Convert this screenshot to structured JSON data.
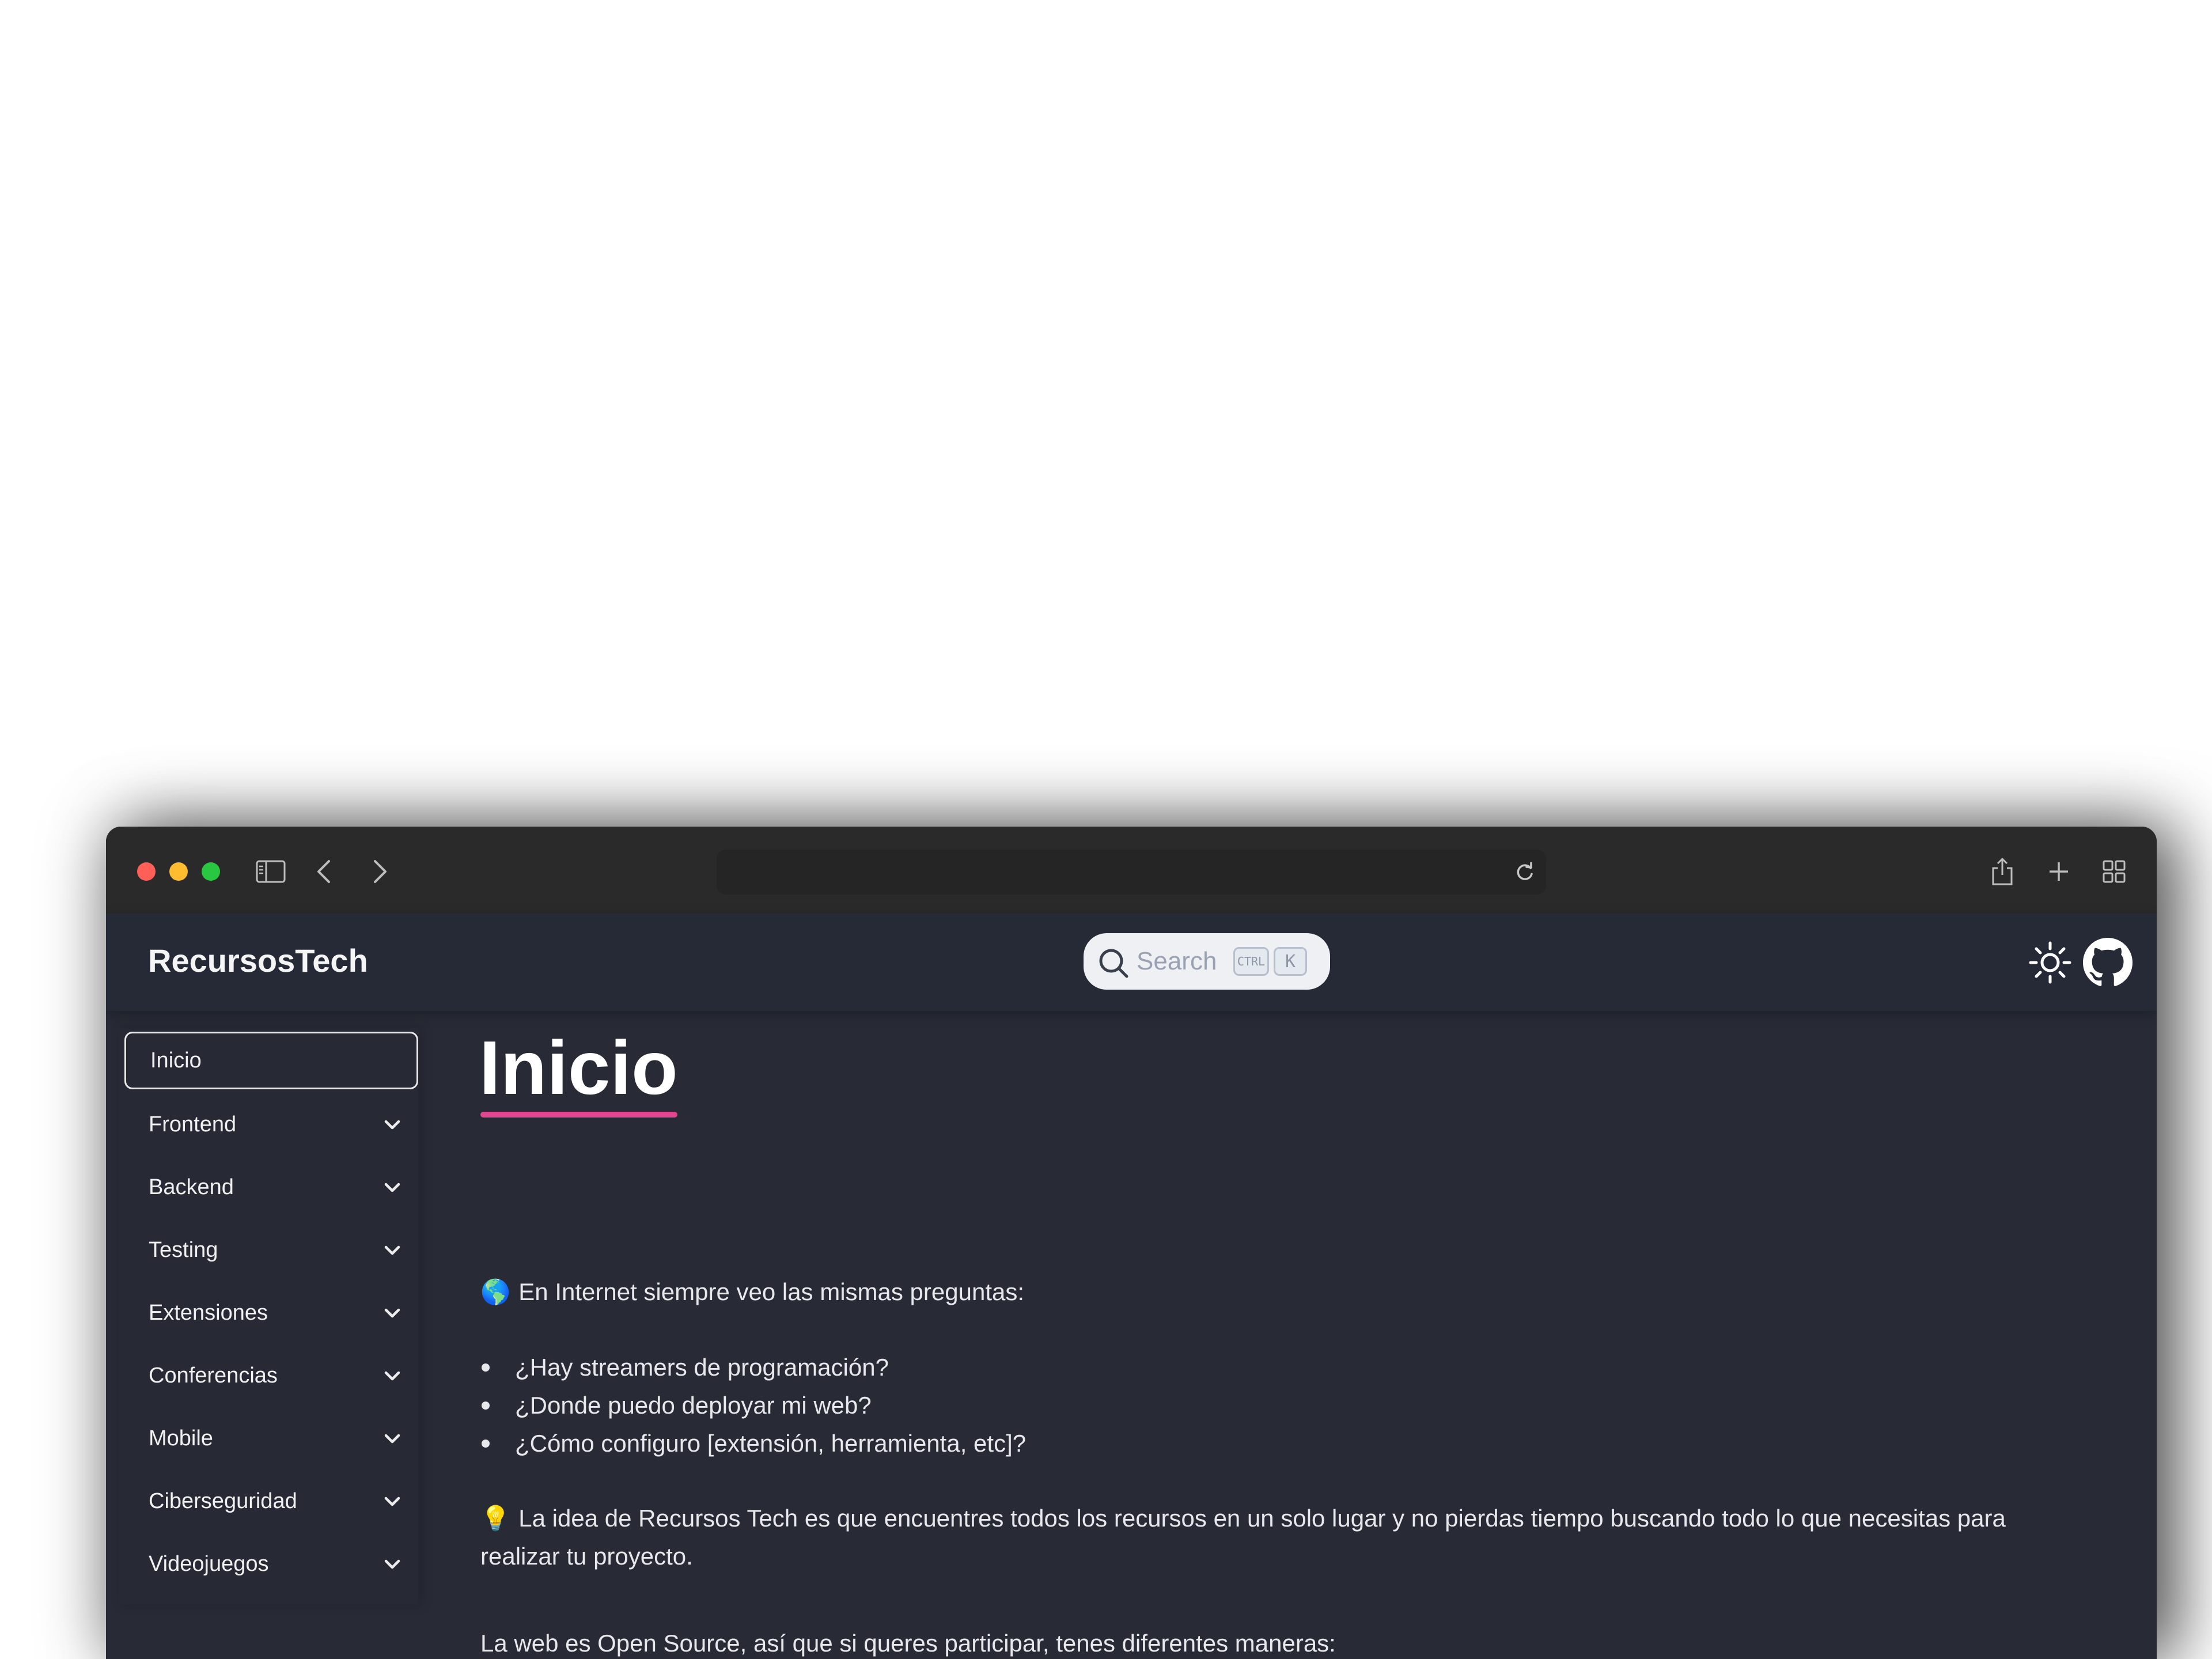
{
  "app": {
    "logo": "RecursosTech"
  },
  "search": {
    "placeholder": "Search",
    "shortcut_ctrl": "CTRL",
    "shortcut_key": "K"
  },
  "sidebar": {
    "items": [
      {
        "label": "Inicio",
        "active": true,
        "expandable": false
      },
      {
        "label": "Frontend",
        "active": false,
        "expandable": true
      },
      {
        "label": "Backend",
        "active": false,
        "expandable": true
      },
      {
        "label": "Testing",
        "active": false,
        "expandable": true
      },
      {
        "label": "Extensiones",
        "active": false,
        "expandable": true
      },
      {
        "label": "Conferencias",
        "active": false,
        "expandable": true
      },
      {
        "label": "Mobile",
        "active": false,
        "expandable": true
      },
      {
        "label": "Ciberseguridad",
        "active": false,
        "expandable": true
      },
      {
        "label": "Videojuegos",
        "active": false,
        "expandable": true
      }
    ]
  },
  "main": {
    "title": "Inicio",
    "intro": "En Internet siempre veo las mismas preguntas:",
    "intro_emoji": "🌎",
    "questions": [
      "¿Hay streamers de programación?",
      "¿Donde puedo deployar mi web?",
      "¿Cómo configuro [extensión, herramienta, etc]?"
    ],
    "idea_emoji": "💡",
    "idea": "La idea de Recursos Tech es que encuentres todos los recursos en un solo lugar y no pierdas tiempo buscando todo lo que necesitas para realizar tu proyecto.",
    "open_source": "La web es Open Source, así que si queres participar, tenes diferentes maneras:"
  },
  "colors": {
    "accent_underline": "#e0468f",
    "background": "#282b36",
    "titlebar": "#2a2a2a"
  },
  "icons": {
    "sidebar_toggle": "sidebar-icon",
    "back": "chevron-left-icon",
    "forward": "chevron-right-icon",
    "reload": "reload-icon",
    "share": "share-icon",
    "new_tab": "plus-icon",
    "tabs": "grid-icon",
    "theme": "sun-icon",
    "repo": "github-icon"
  }
}
